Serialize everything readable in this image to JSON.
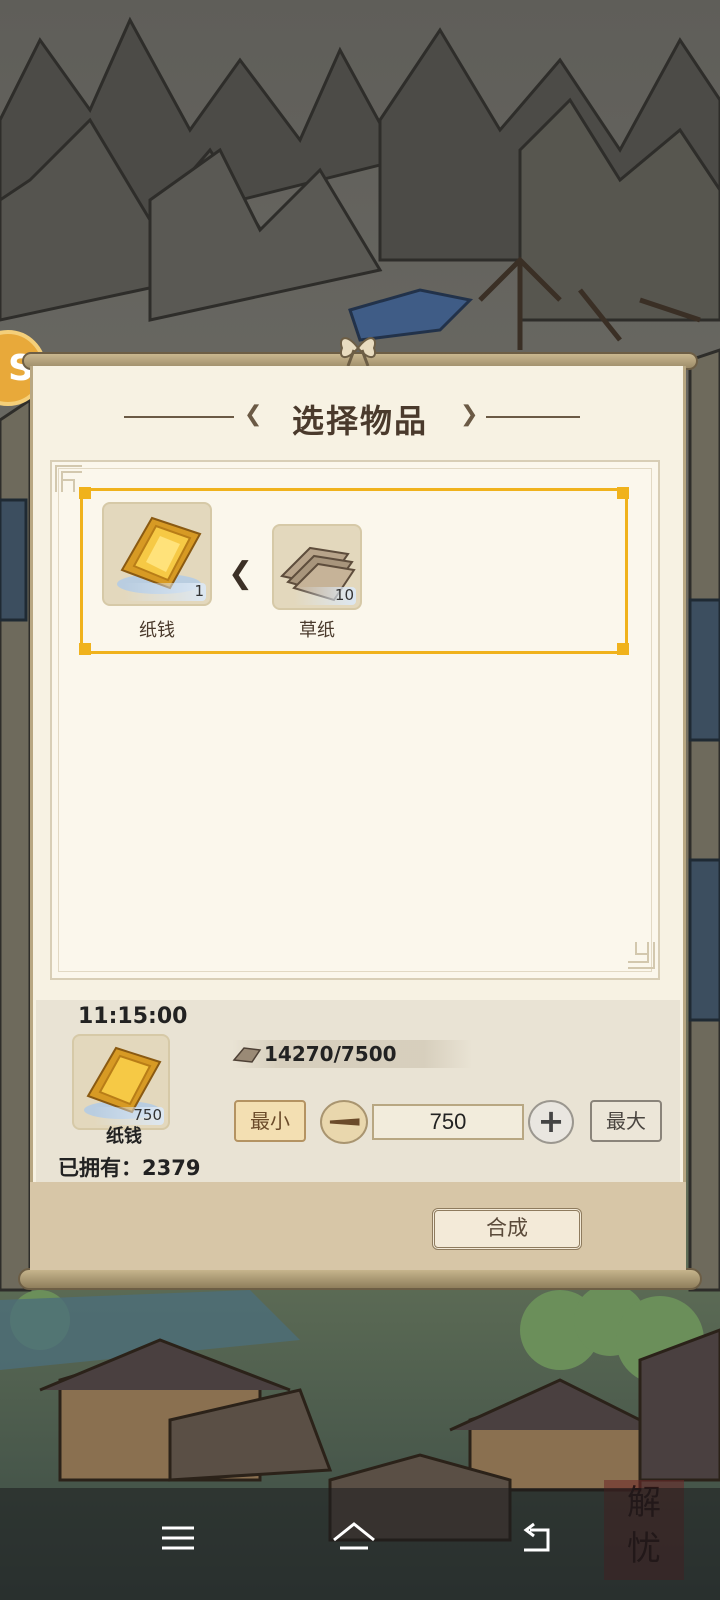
{
  "dialog": {
    "title": "选择物品"
  },
  "recipe": {
    "output": {
      "name": "纸钱",
      "quantity": "1",
      "icon": "paper-money-icon"
    },
    "input": {
      "name": "草纸",
      "quantity": "10",
      "icon": "straw-paper-icon"
    }
  },
  "craft": {
    "time": "11:15:00",
    "item_name": "纸钱",
    "item_quantity": "750",
    "owned_label": "已拥有：2379",
    "requirement": "14270/7500",
    "min_label": "最小",
    "max_label": "最大",
    "amount": "750",
    "craft_label": "合成"
  },
  "side": {
    "badge_char": "S"
  },
  "stamp": {
    "text": "解忧"
  },
  "colors": {
    "highlight": "#f0b21c",
    "panel": "#f7f2e3",
    "text": "#4a3a2c"
  }
}
